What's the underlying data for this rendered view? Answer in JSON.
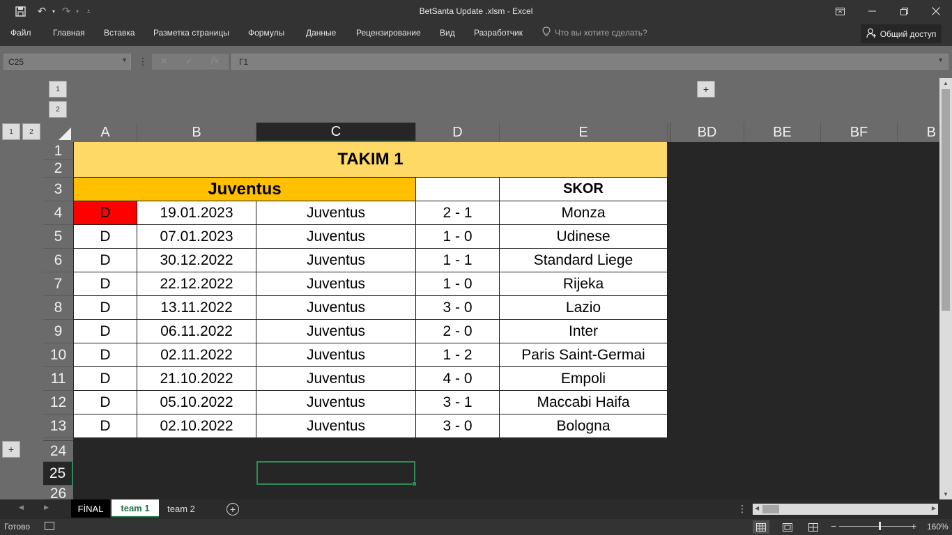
{
  "window": {
    "title": "BetSanta Update .xlsm - Excel",
    "qat": {
      "save_icon": "save-icon",
      "undo_icon": "undo-icon",
      "redo_icon": "redo-icon",
      "customize_icon": "chevron-down-icon"
    },
    "controls": {
      "ribbon_display": "ribbon-display-icon",
      "minimize": "minimize-icon",
      "restore": "restore-icon",
      "close": "close-icon"
    }
  },
  "ribbon": {
    "tabs": [
      "Файл",
      "Главная",
      "Вставка",
      "Разметка страницы",
      "Формулы",
      "Данные",
      "Рецензирование",
      "Вид",
      "Разработчик"
    ],
    "tell_me": "Что вы хотите сделать?",
    "share": "Общий доступ"
  },
  "formula_bar": {
    "name_box": "C25",
    "formula": "Г1",
    "fx_label": "fx",
    "cancel_label": "✕",
    "enter_label": "✓"
  },
  "outline": {
    "row_levels": [
      "1",
      "2"
    ],
    "col_levels": [
      "1",
      "2"
    ],
    "expand_label": "+"
  },
  "columns": [
    "A",
    "B",
    "C",
    "D",
    "E",
    "BD",
    "BE",
    "BF",
    "B"
  ],
  "rows": [
    "1",
    "2",
    "3",
    "4",
    "5",
    "6",
    "7",
    "8",
    "9",
    "10",
    "11",
    "12",
    "13",
    "24",
    "25",
    "26"
  ],
  "sheet": {
    "title": "TAKIM 1",
    "team": "Juventus",
    "score_header": "SKOR",
    "matches": [
      {
        "result": "D",
        "date": "19.01.2023",
        "team": "Juventus",
        "score": "2 - 1",
        "opponent": "Monza"
      },
      {
        "result": "D",
        "date": "07.01.2023",
        "team": "Juventus",
        "score": "1 - 0",
        "opponent": "Udinese"
      },
      {
        "result": "D",
        "date": "30.12.2022",
        "team": "Juventus",
        "score": "1 - 1",
        "opponent": "Standard Liege"
      },
      {
        "result": "D",
        "date": "22.12.2022",
        "team": "Juventus",
        "score": "1 - 0",
        "opponent": "Rijeka"
      },
      {
        "result": "D",
        "date": "13.11.2022",
        "team": "Juventus",
        "score": "3 - 0",
        "opponent": "Lazio"
      },
      {
        "result": "D",
        "date": "06.11.2022",
        "team": "Juventus",
        "score": "2 - 0",
        "opponent": "Inter"
      },
      {
        "result": "D",
        "date": "02.11.2022",
        "team": "Juventus",
        "score": "1 - 2",
        "opponent": "Paris Saint-Germai"
      },
      {
        "result": "D",
        "date": "21.10.2022",
        "team": "Juventus",
        "score": "4 - 0",
        "opponent": "Empoli"
      },
      {
        "result": "D",
        "date": "05.10.2022",
        "team": "Juventus",
        "score": "3 - 1",
        "opponent": "Maccabi Haifa"
      },
      {
        "result": "D",
        "date": "02.10.2022",
        "team": "Juventus",
        "score": "3 - 0",
        "opponent": "Bologna"
      }
    ]
  },
  "sheet_tabs": [
    "FİNAL",
    "team 1",
    "team 2"
  ],
  "active_sheet": "team 1",
  "status": {
    "ready": "Готово",
    "zoom": "160%"
  },
  "colors": {
    "title_fill": "#FFD966",
    "team_fill": "#FFC000",
    "highlight_fill": "#FF0000",
    "active_tab_text": "#1E7145",
    "selection": "#2E8B57"
  }
}
